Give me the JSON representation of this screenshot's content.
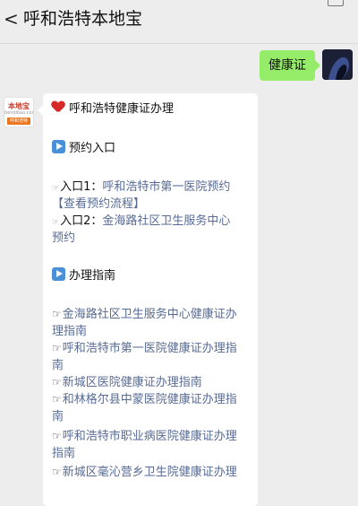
{
  "header": {
    "title": "呼和浩特本地宝",
    "back_glyph": "<"
  },
  "outgoing": {
    "text": "健康证"
  },
  "incoming": {
    "avatar_logo": {
      "top": "本地宝",
      "sub": "bendibao.com",
      "bottom": "呼和浩特"
    },
    "heading": "呼和浩特健康证办理",
    "section1_title": "预约入口",
    "entry1_prefix": "入口1：",
    "entry1_link": "呼和浩特市第一医院预约",
    "entry1_process": "【查看预约流程】",
    "entry2_prefix": "入口2：",
    "entry2_link_a": "金海路社区卫生服务中心",
    "entry2_link_b": "预约",
    "section2_title": "办理指南",
    "guides": [
      {
        "a": "金海路社区卫生服务中心健康证办",
        "b": "理指南"
      },
      {
        "a": "呼和浩特市第一医院健康证办理指",
        "b": "南"
      },
      {
        "a": "新城区医院健康证办理指南",
        "b": ""
      },
      {
        "a": "和林格尔县中蒙医院健康证办理指",
        "b": "南"
      },
      {
        "a": "呼和浩特市职业病医院健康证办理",
        "b": "指南"
      },
      {
        "a": "新城区毫沁营乡卫生院健康证办理",
        "b": ""
      }
    ],
    "hand_glyph": "☞"
  },
  "colors": {
    "link": "#576b95",
    "outgoing_bubble": "#95ec69",
    "background": "#ededed"
  }
}
